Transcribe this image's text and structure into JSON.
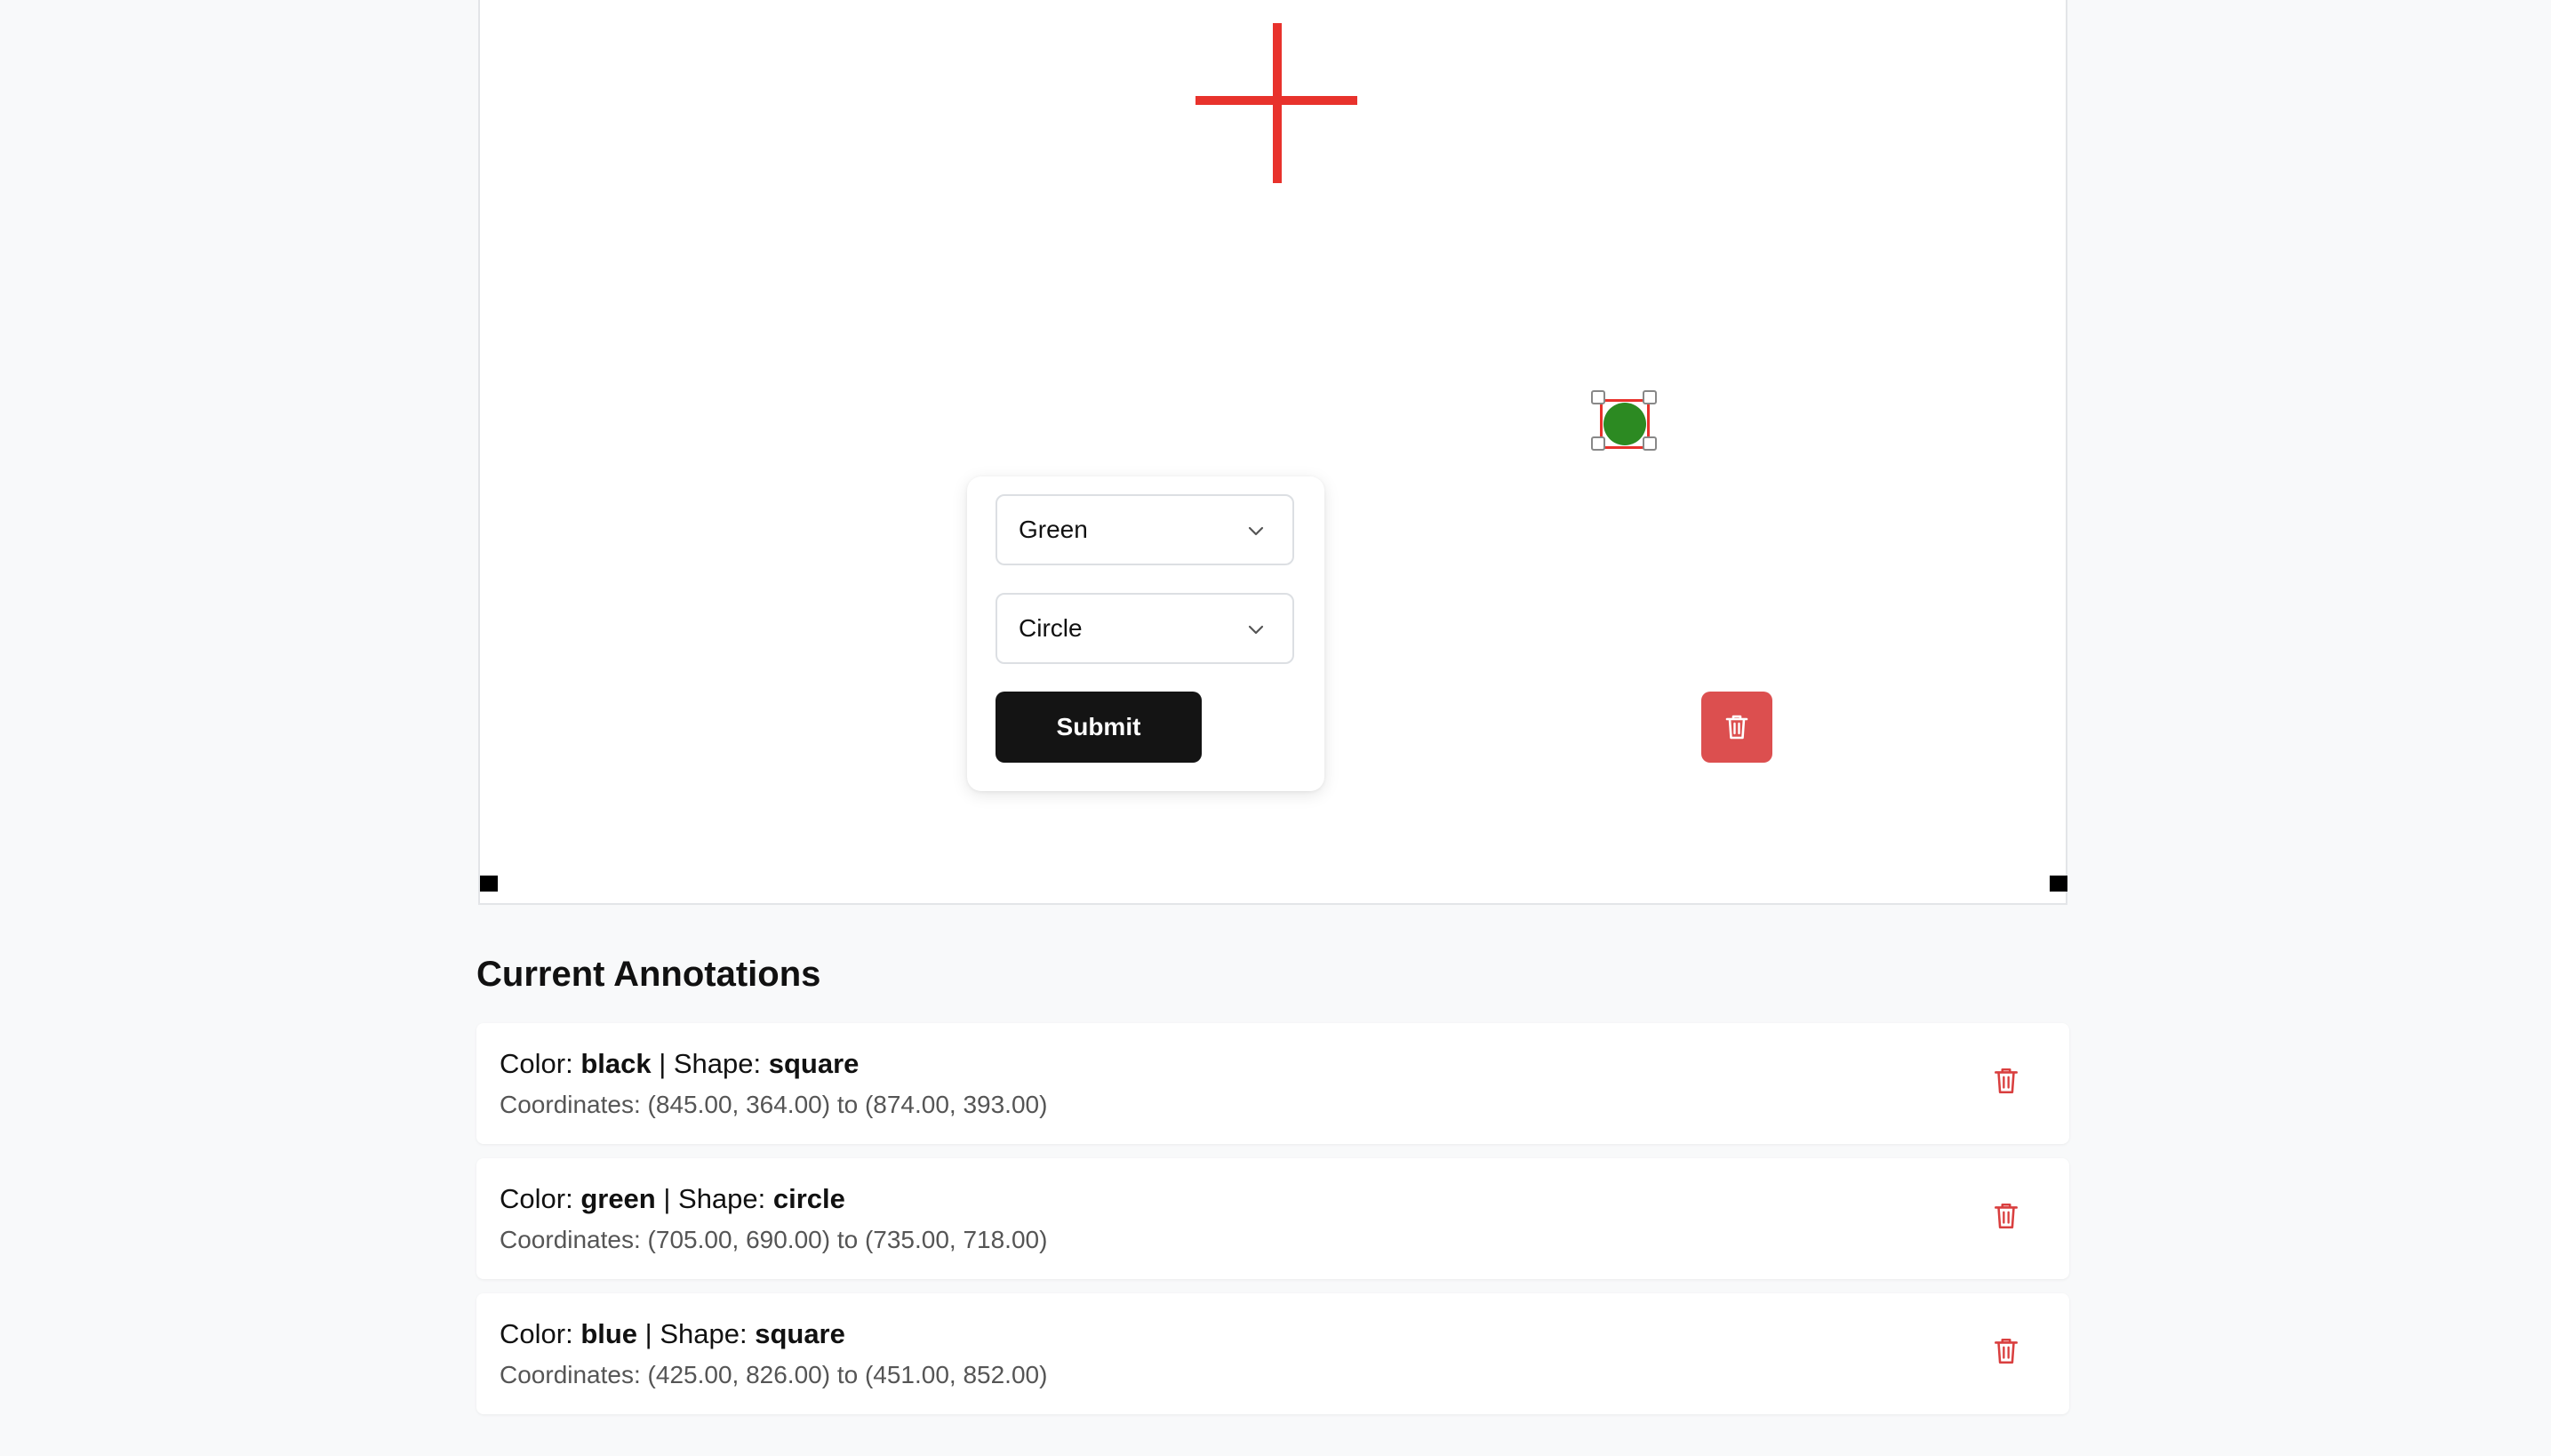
{
  "popup": {
    "color_select": {
      "value": "Green"
    },
    "shape_select": {
      "value": "Circle"
    },
    "submit_label": "Submit"
  },
  "annotations": {
    "title": "Current Annotations",
    "color_prefix": "Color: ",
    "shape_prefix": " | Shape: ",
    "coords_prefix": "Coordinates: ",
    "items": [
      {
        "color": "black",
        "shape": "square",
        "coords": "(845.00, 364.00) to (874.00, 393.00)"
      },
      {
        "color": "green",
        "shape": "circle",
        "coords": "(705.00, 690.00) to (735.00, 718.00)"
      },
      {
        "color": "blue",
        "shape": "square",
        "coords": "(425.00, 826.00) to (451.00, 852.00)"
      }
    ]
  },
  "colors": {
    "crosshair": "#e8322c",
    "blue_shape": "#0000ff",
    "green_shape": "#2c8a22",
    "submit_bg": "#141414",
    "delete_bg": "#dc4f4f",
    "trash_icon": "#d93f3f"
  },
  "icons": {
    "crosshair": "crosshair-icon",
    "chevron": "chevron-down-icon",
    "trash": "trash-icon"
  }
}
